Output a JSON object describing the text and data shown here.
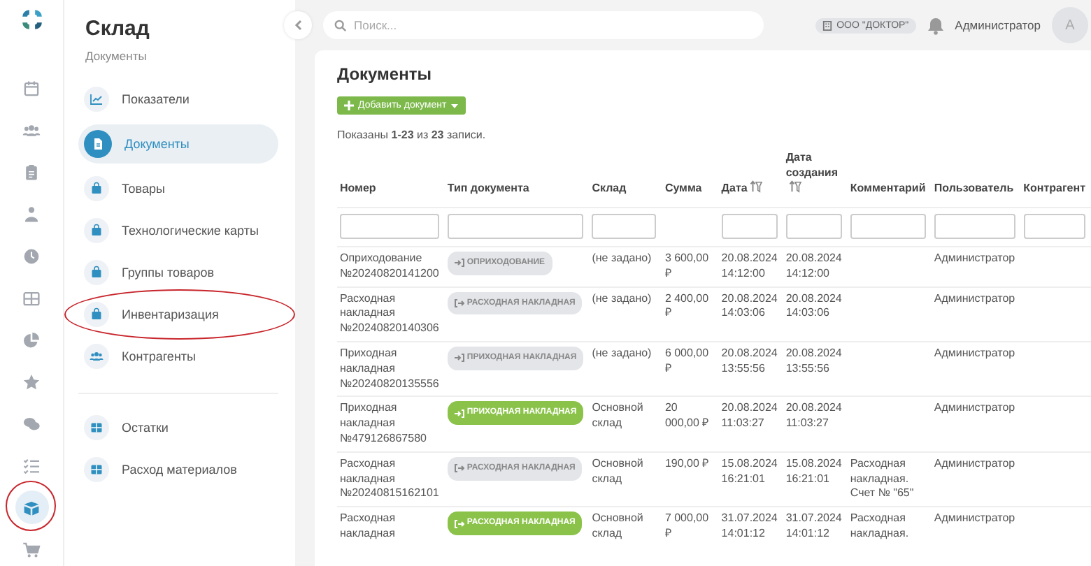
{
  "rail": {
    "items": [
      {
        "selected": false,
        "highlighted": false
      },
      {
        "selected": false,
        "highlighted": false
      },
      {
        "selected": false,
        "highlighted": false
      },
      {
        "selected": false,
        "highlighted": false
      },
      {
        "selected": false,
        "highlighted": false
      },
      {
        "selected": false,
        "highlighted": false
      },
      {
        "selected": false,
        "highlighted": false
      },
      {
        "selected": false,
        "highlighted": false
      },
      {
        "selected": false,
        "highlighted": false
      },
      {
        "selected": false,
        "highlighted": false
      },
      {
        "selected": true,
        "highlighted": true
      },
      {
        "selected": false,
        "highlighted": false
      }
    ]
  },
  "sidebar": {
    "title": "Склад",
    "subtitle": "Документы",
    "groups": [
      {
        "items": [
          {
            "label": "Показатели",
            "selected": false,
            "highlighted": false
          },
          {
            "label": "Документы",
            "selected": true,
            "highlighted": false
          },
          {
            "label": "Товары",
            "selected": false,
            "highlighted": false
          },
          {
            "label": "Технологические карты",
            "selected": false,
            "highlighted": false
          },
          {
            "label": "Группы товаров",
            "selected": false,
            "highlighted": false
          },
          {
            "label": "Инвентаризация",
            "selected": false,
            "highlighted": true
          },
          {
            "label": "Контрагенты",
            "selected": false,
            "highlighted": false
          }
        ]
      },
      {
        "items": [
          {
            "label": "Остатки",
            "selected": false,
            "highlighted": false
          },
          {
            "label": "Расход материалов",
            "selected": false,
            "highlighted": false
          }
        ]
      }
    ]
  },
  "topbar": {
    "search": {
      "placeholder": "Поиск..."
    },
    "company": "ООО \"ДОКТОР\"",
    "user": "Администратор",
    "avatar": "А"
  },
  "content": {
    "title": "Документы",
    "add_button": "Добавить документ",
    "summary": "Показаны **1-23** из **23** записи.",
    "table": {
      "columns": [
        {
          "label": "Номер",
          "sortable": false,
          "filter": true
        },
        {
          "label": "Тип документа",
          "sortable": false,
          "filter": true
        },
        {
          "label": "Склад",
          "sortable": false,
          "filter": true
        },
        {
          "label": "Сумма",
          "sortable": false,
          "filter": false
        },
        {
          "label": "Дата",
          "sortable": true,
          "filter": true
        },
        {
          "label": "Дата создания",
          "sortable": true,
          "filter": true
        },
        {
          "label": "Комментарий",
          "sortable": false,
          "filter": true
        },
        {
          "label": "Пользователь",
          "sortable": false,
          "filter": true
        },
        {
          "label": "Контрагент",
          "sortable": false,
          "filter": true
        }
      ],
      "rows": [
        {
          "number": "Оприходование №20240820141200",
          "type": {
            "label": "ОПРИХОДОВАНИЕ",
            "kind": "in",
            "posted": false
          },
          "warehouse": "(не задано)",
          "sum": "3 600,00 ₽",
          "date": "20.08.2024 14:12:00",
          "created": "20.08.2024 14:12:00",
          "user": "Администратор"
        },
        {
          "number": "Расходная накладная №20240820140306",
          "type": {
            "label": "РАСХОДНАЯ НАКЛАДНАЯ",
            "kind": "out",
            "posted": false
          },
          "warehouse": "(не задано)",
          "sum": "2 400,00 ₽",
          "date": "20.08.2024 14:03:06",
          "created": "20.08.2024 14:03:06",
          "user": "Администратор"
        },
        {
          "number": "Приходная накладная №20240820135556",
          "type": {
            "label": "ПРИХОДНАЯ НАКЛАДНАЯ",
            "kind": "in",
            "posted": false
          },
          "warehouse": "(не задано)",
          "sum": "6 000,00 ₽",
          "date": "20.08.2024 13:55:56",
          "created": "20.08.2024 13:55:56",
          "user": "Администратор"
        },
        {
          "number": "Приходная накладная №479126867580",
          "type": {
            "label": "ПРИХОДНАЯ НАКЛАДНАЯ",
            "kind": "in",
            "posted": true
          },
          "warehouse": "Основной склад",
          "sum": "20 000,00 ₽",
          "date": "20.08.2024 11:03:27",
          "created": "20.08.2024 11:03:27",
          "user": "Администратор"
        },
        {
          "number": "Расходная накладная №20240815162101",
          "type": {
            "label": "РАСХОДНАЯ НАКЛАДНАЯ",
            "kind": "out",
            "posted": false
          },
          "warehouse": "Основной склад",
          "sum": "190,00 ₽",
          "date": "15.08.2024 16:21:01",
          "created": "15.08.2024 16:21:01",
          "comment": "Расходная накладная. Счет № \"65\"",
          "user": "Администратор"
        },
        {
          "number": "Расходная накладная",
          "type": {
            "label": "РАСХОДНАЯ НАКЛАДНАЯ",
            "kind": "out",
            "posted": true
          },
          "warehouse": "Основной склад",
          "sum": "7 000,00 ₽",
          "date": "31.07.2024 14:01:12",
          "created": "31.07.2024 14:01:12",
          "comment": "Расходная накладная.",
          "user": "Администратор"
        }
      ]
    }
  }
}
